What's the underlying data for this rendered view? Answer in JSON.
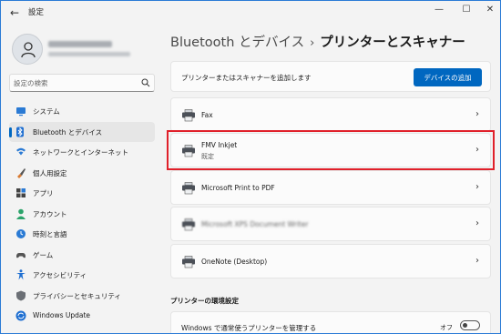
{
  "window": {
    "title": "設定"
  },
  "profile": {},
  "search": {
    "placeholder": "設定の検索"
  },
  "nav": [
    {
      "label": "システム",
      "icon": "system-icon"
    },
    {
      "label": "Bluetooth とデバイス",
      "icon": "bluetooth-icon",
      "selected": true
    },
    {
      "label": "ネットワークとインターネット",
      "icon": "network-icon"
    },
    {
      "label": "個人用設定",
      "icon": "personalization-icon"
    },
    {
      "label": "アプリ",
      "icon": "apps-icon"
    },
    {
      "label": "アカウント",
      "icon": "account-icon"
    },
    {
      "label": "時刻と言語",
      "icon": "time-language-icon"
    },
    {
      "label": "ゲーム",
      "icon": "gaming-icon"
    },
    {
      "label": "アクセシビリティ",
      "icon": "accessibility-icon"
    },
    {
      "label": "プライバシーとセキュリティ",
      "icon": "privacy-security-icon"
    },
    {
      "label": "Windows Update",
      "icon": "windows-update-icon"
    }
  ],
  "breadcrumb": {
    "parent": "Bluetooth とデバイス",
    "separator": "›",
    "current": "プリンターとスキャナー"
  },
  "add_device": {
    "label": "プリンターまたはスキャナーを追加します",
    "button": "デバイスの追加"
  },
  "printers": [
    {
      "name": "Fax",
      "sub": ""
    },
    {
      "name": "FMV Inkjet",
      "sub": "既定",
      "highlighted": true
    },
    {
      "name": "Microsoft Print to PDF",
      "sub": ""
    },
    {
      "name": "Microsoft XPS Document Writer",
      "sub": "",
      "blurred": true
    },
    {
      "name": "OneNote (Desktop)",
      "sub": ""
    }
  ],
  "preferences": {
    "title": "プリンターの環境設定",
    "manage_default": {
      "label": "Windows で通常使うプリンターを管理する",
      "state": "オフ",
      "on": false
    }
  },
  "colors": {
    "accent": "#0067c0",
    "highlight": "#e0202a"
  }
}
